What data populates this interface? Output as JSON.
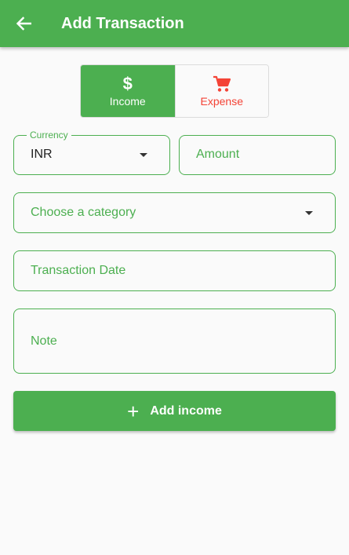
{
  "appbar": {
    "title": "Add Transaction",
    "back_icon": "arrow-left-icon",
    "color": "#4caf50"
  },
  "type_toggle": {
    "selected": "income",
    "income": {
      "label": "Income",
      "icon": "dollar-icon",
      "icon_glyph": "$",
      "color": "#4caf50"
    },
    "expense": {
      "label": "Expense",
      "icon": "cart-icon",
      "color": "#f44336"
    }
  },
  "form": {
    "currency": {
      "label": "Currency",
      "value": "INR"
    },
    "amount": {
      "placeholder": "Amount"
    },
    "category": {
      "placeholder": "Choose a category"
    },
    "date": {
      "placeholder": "Transaction Date"
    },
    "note": {
      "placeholder": "Note"
    }
  },
  "submit": {
    "label": "Add income",
    "icon": "plus-icon",
    "icon_glyph": "+"
  }
}
